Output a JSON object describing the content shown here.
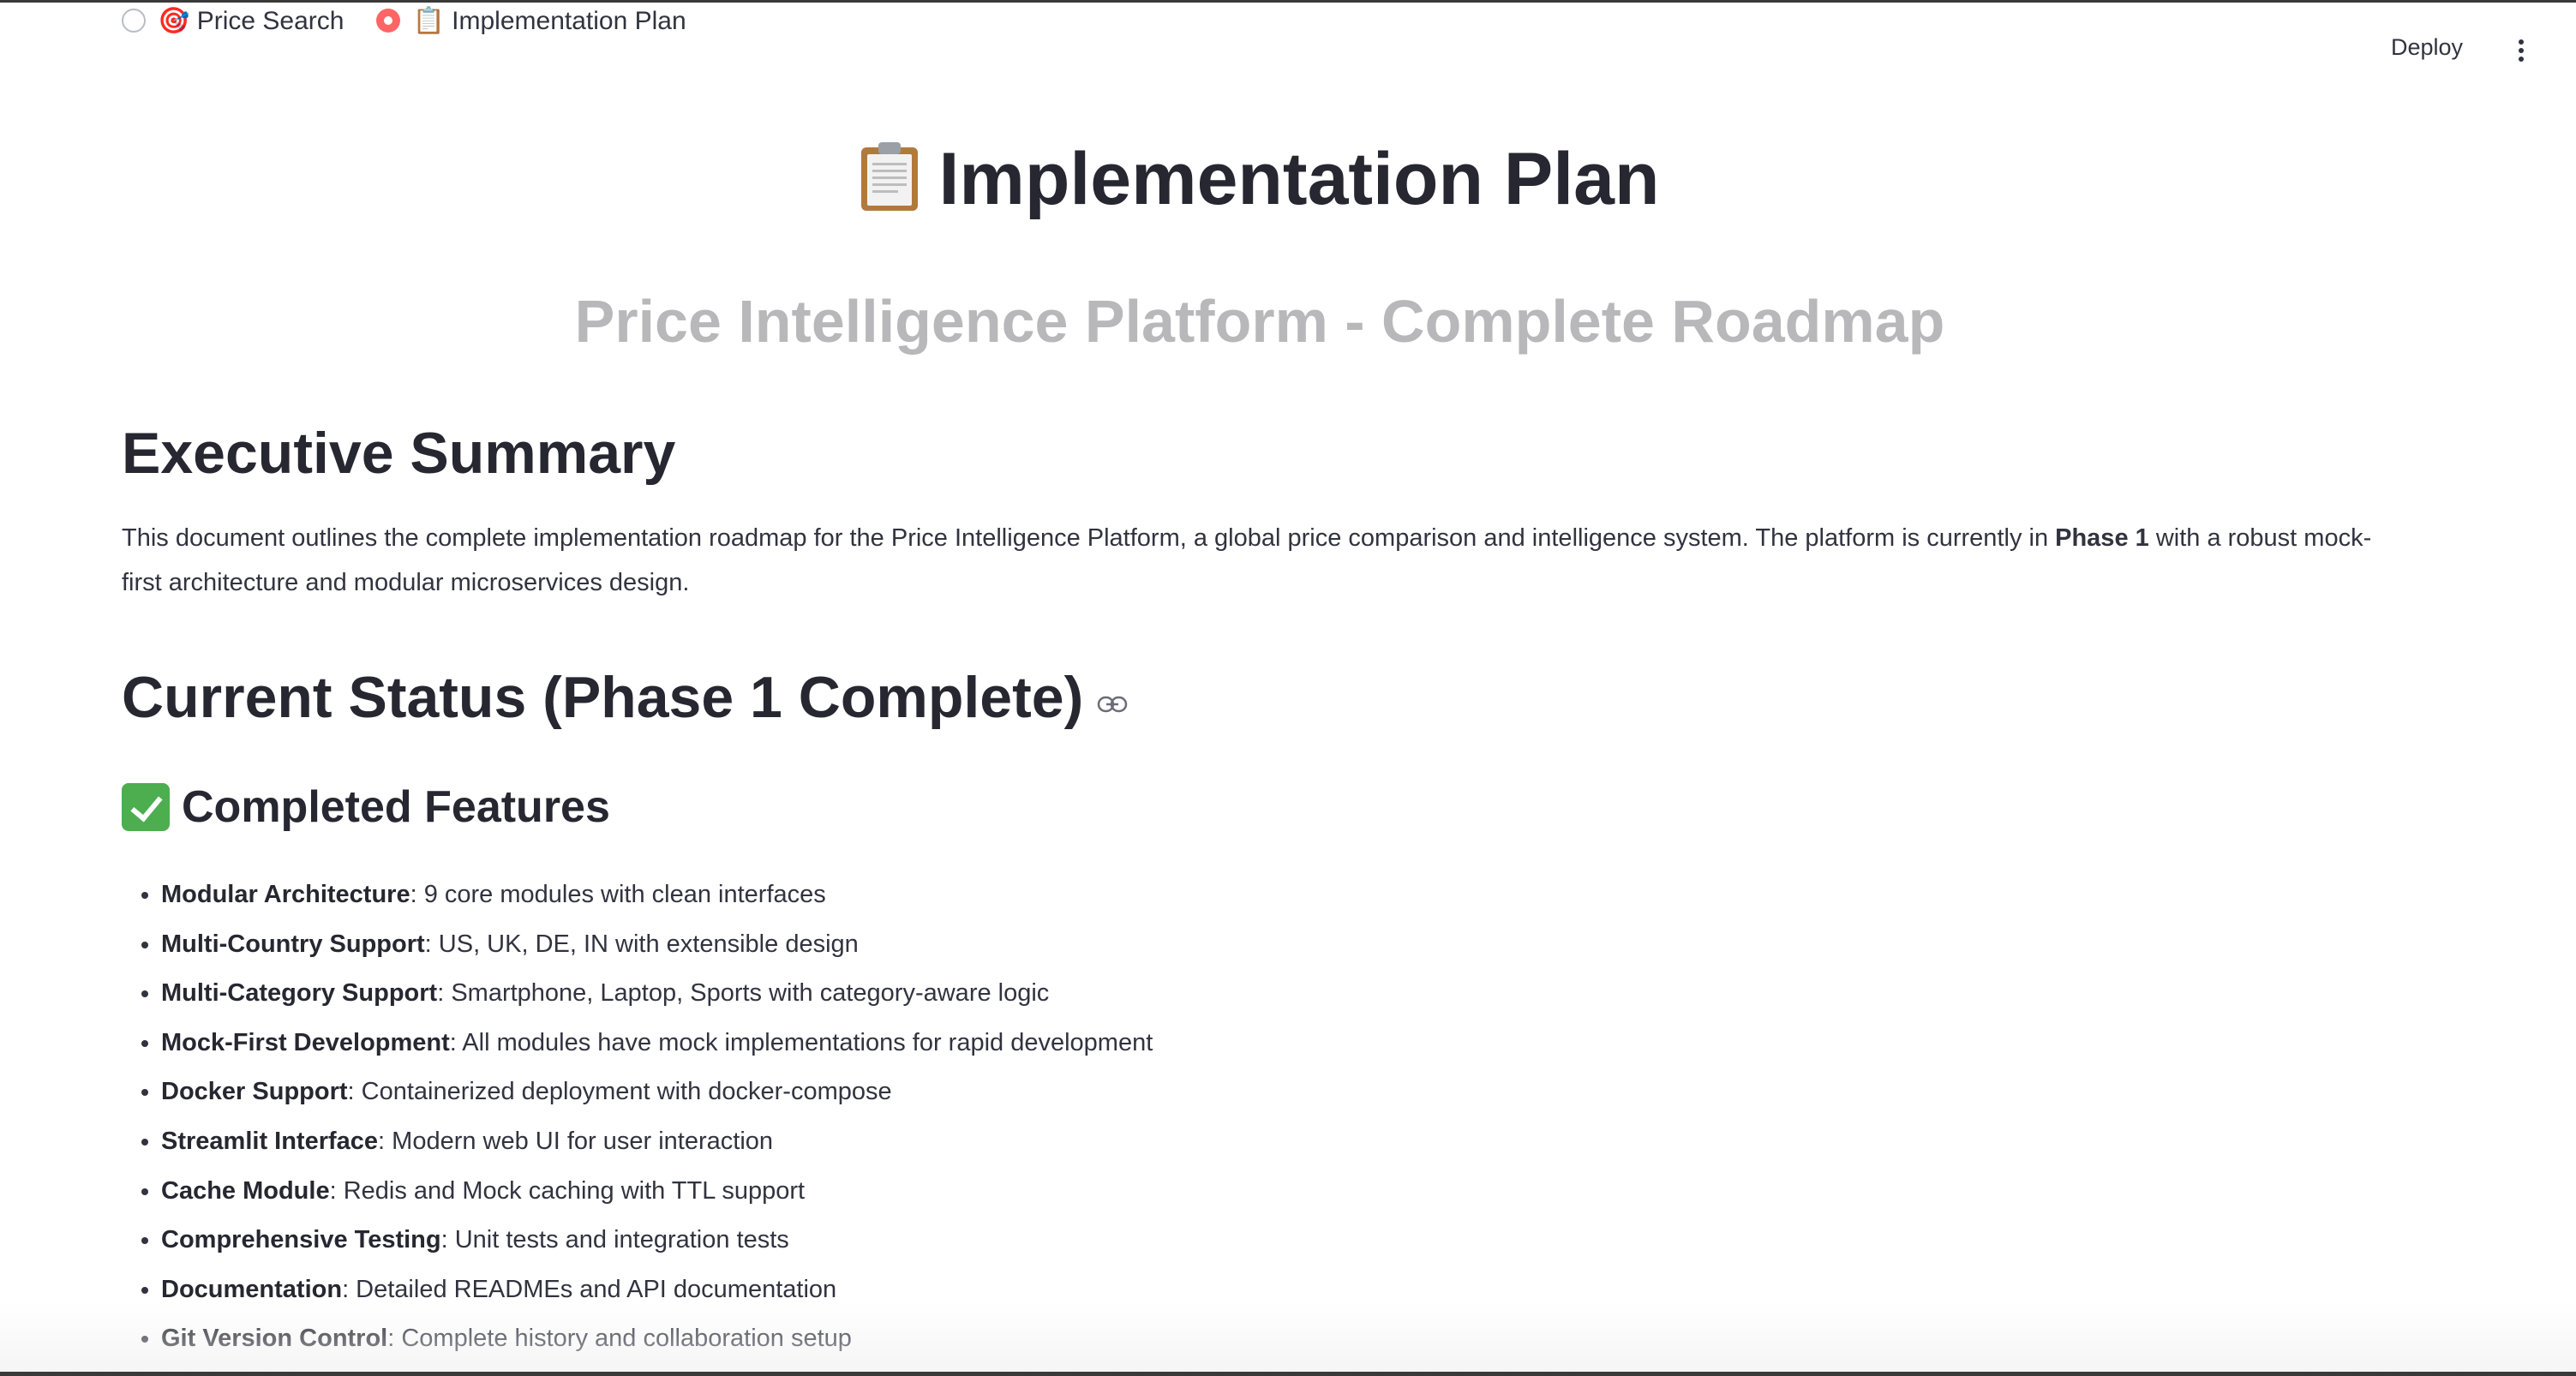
{
  "nav": {
    "options": [
      {
        "emoji": "🎯",
        "label": "Price Search",
        "selected": false
      },
      {
        "emoji": "📋",
        "label": "Implementation Plan",
        "selected": true
      }
    ],
    "selected_color": "#ff4b4b"
  },
  "header": {
    "deploy_label": "Deploy",
    "menu_icon": "vertical-ellipsis-icon"
  },
  "main": {
    "title": "Implementation Plan",
    "title_icon": "clipboard-icon",
    "subtitle": "Price Intelligence Platform - Complete Roadmap",
    "executive_summary": {
      "heading": "Executive Summary",
      "text_before_bold": "This document outlines the complete implementation roadmap for the Price Intelligence Platform, a global price comparison and intelligence system. The platform is currently in ",
      "bold": "Phase 1",
      "text_after_bold": " with a robust mock-first architecture and modular microservices design."
    },
    "current_status": {
      "heading": "Current Status (Phase 1 Complete)",
      "anchor_icon": "link-icon"
    },
    "completed_features": {
      "heading": "Completed Features",
      "heading_icon": "check-mark-icon",
      "items": [
        {
          "name": "Modular Architecture",
          "desc": ": 9 core modules with clean interfaces"
        },
        {
          "name": "Multi-Country Support",
          "desc": ": US, UK, DE, IN with extensible design"
        },
        {
          "name": "Multi-Category Support",
          "desc": ": Smartphone, Laptop, Sports with category-aware logic"
        },
        {
          "name": "Mock-First Development",
          "desc": ": All modules have mock implementations for rapid development"
        },
        {
          "name": "Docker Support",
          "desc": ": Containerized deployment with docker-compose"
        },
        {
          "name": "Streamlit Interface",
          "desc": ": Modern web UI for user interaction"
        },
        {
          "name": "Cache Module",
          "desc": ": Redis and Mock caching with TTL support"
        },
        {
          "name": "Comprehensive Testing",
          "desc": ": Unit tests and integration tests"
        },
        {
          "name": "Documentation",
          "desc": ": Detailed READMEs and API documentation"
        },
        {
          "name": "Git Version Control",
          "desc": ": Complete history and collaboration setup"
        }
      ]
    }
  }
}
